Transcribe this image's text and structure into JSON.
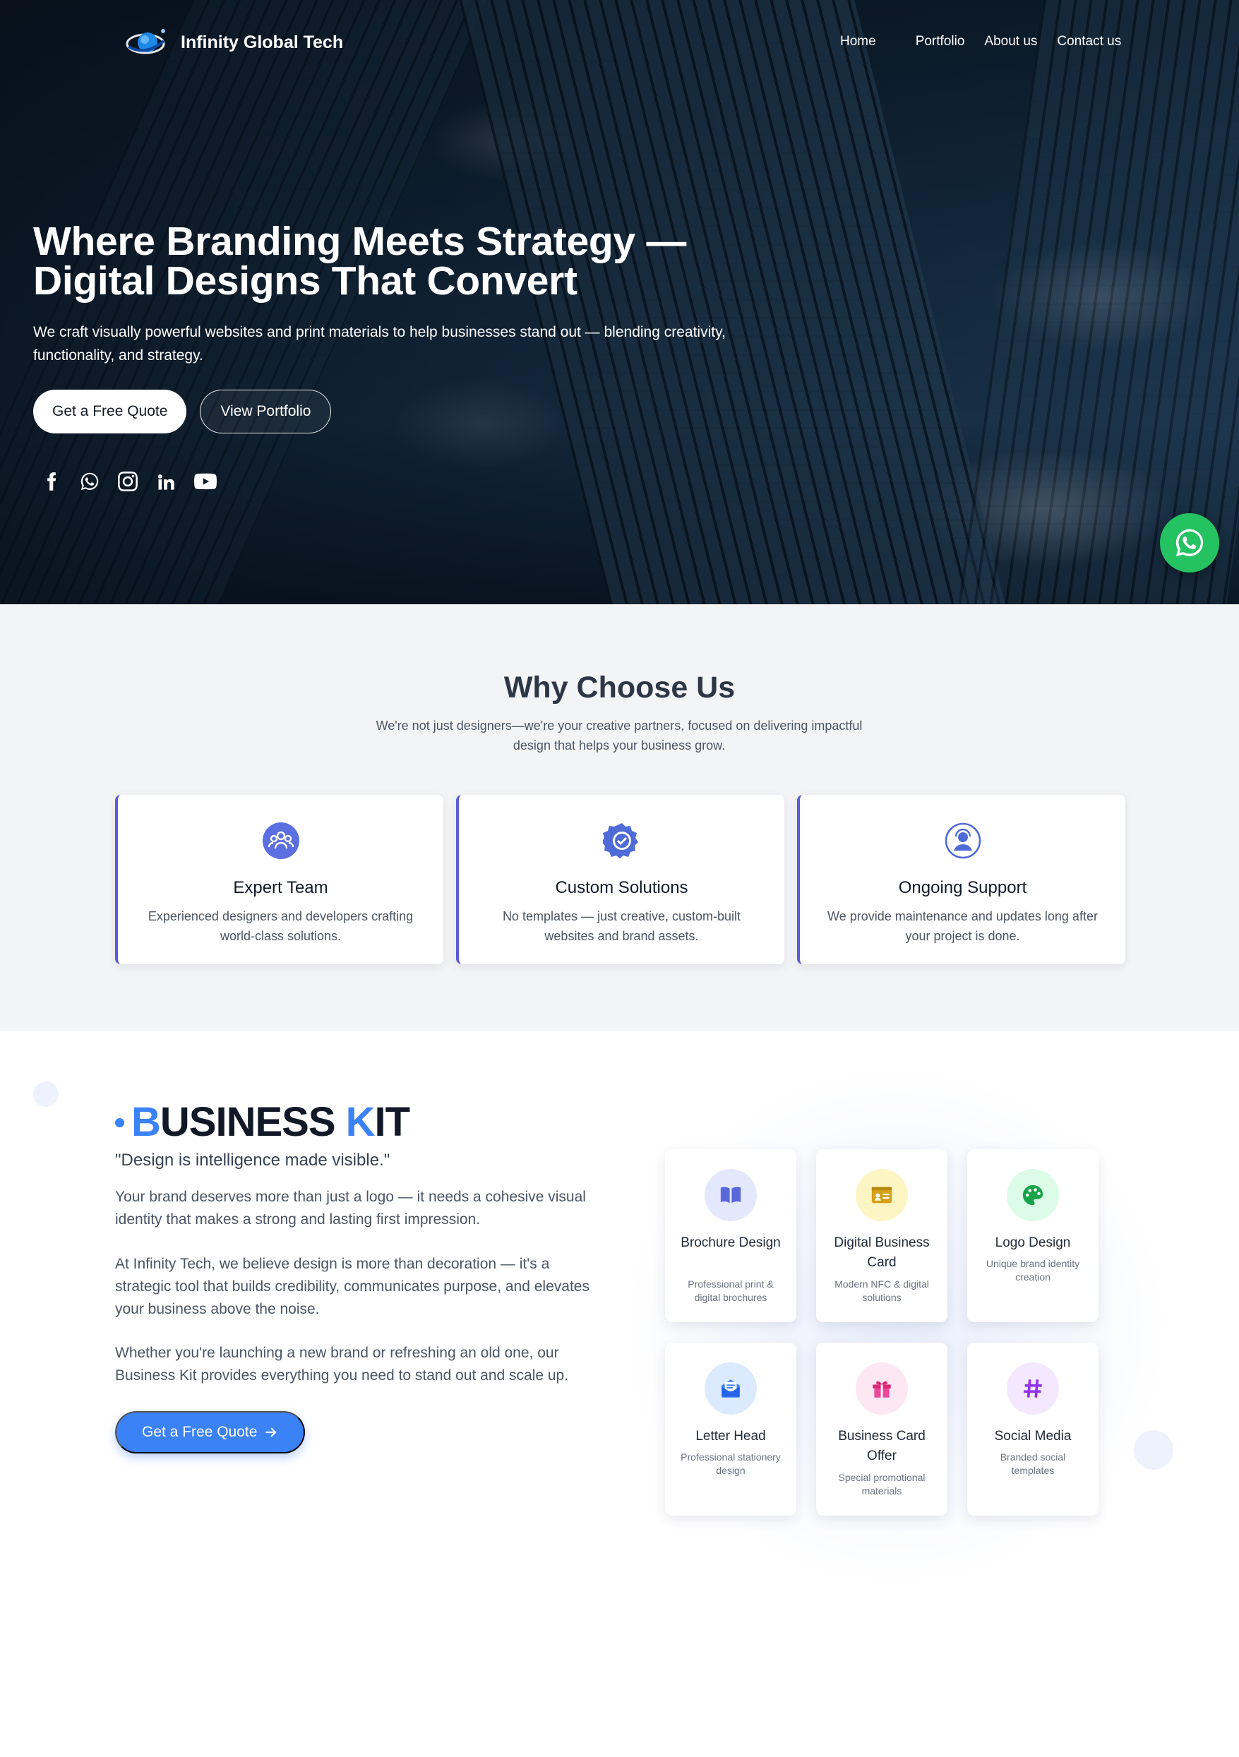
{
  "nav": {
    "brand": "Infinity Global Tech",
    "links": [
      "Home",
      "Portfolio",
      "About us",
      "Contact us"
    ]
  },
  "hero": {
    "title_line1": "Where Branding Meets Strategy —",
    "title_line2": "Digital Designs That Convert",
    "subtitle": "We craft visually powerful websites and print materials to help businesses stand out — blending creativity, functionality, and strategy.",
    "primary_cta": "Get a Free Quote",
    "secondary_cta": "View Portfolio",
    "socials": [
      "facebook-icon",
      "whatsapp-icon",
      "instagram-icon",
      "linkedin-icon",
      "youtube-icon"
    ]
  },
  "why": {
    "title": "Why Choose Us",
    "subtitle": "We're not just designers—we're your creative partners, focused on delivering impactful design that helps your business grow.",
    "cards": [
      {
        "icon": "team-icon",
        "title": "Expert Team",
        "text": "Experienced designers and developers crafting world-class solutions."
      },
      {
        "icon": "badge-check-icon",
        "title": "Custom Solutions",
        "text": "No templates — just creative, custom-built websites and brand assets."
      },
      {
        "icon": "support-agent-icon",
        "title": "Ongoing Support",
        "text": "We provide maintenance and updates long after your project is done."
      }
    ]
  },
  "kit": {
    "title_b1": "B",
    "title_rest1": "USINESS ",
    "title_b2": "K",
    "title_rest2": "IT",
    "quote": "\"Design is intelligence made visible.\"",
    "p1": "Your brand deserves more than just a logo — it needs a cohesive visual identity that makes a strong and lasting first impression.",
    "p2": "At Infinity Tech, we believe design is more than decoration — it's a strategic tool that builds credibility, communicates purpose, and elevates your business above the noise.",
    "p3": "Whether you're launching a new brand or refreshing an old one, our Business Kit provides everything you need to stand out and scale up.",
    "cta": "Get a Free Quote",
    "items": [
      {
        "icon": "book-icon",
        "title": "Brochure Design",
        "desc": "Professional print & digital brochures"
      },
      {
        "icon": "id-card-icon",
        "title": "Digital Business Card",
        "desc": "Modern NFC & digital solutions"
      },
      {
        "icon": "palette-icon",
        "title": "Logo Design",
        "desc": "Unique brand identity creation"
      },
      {
        "icon": "envelope-open-icon",
        "title": "Letter Head",
        "desc": "Professional stationery design"
      },
      {
        "icon": "gift-icon",
        "title": "Business Card Offer",
        "desc": "Special promotional materials"
      },
      {
        "icon": "hashtag-icon",
        "title": "Social Media",
        "desc": "Branded social templates"
      }
    ]
  },
  "colors": {
    "accent": "#3b82f6",
    "why_border": "#5b5bd6",
    "whatsapp": "#25c261"
  }
}
